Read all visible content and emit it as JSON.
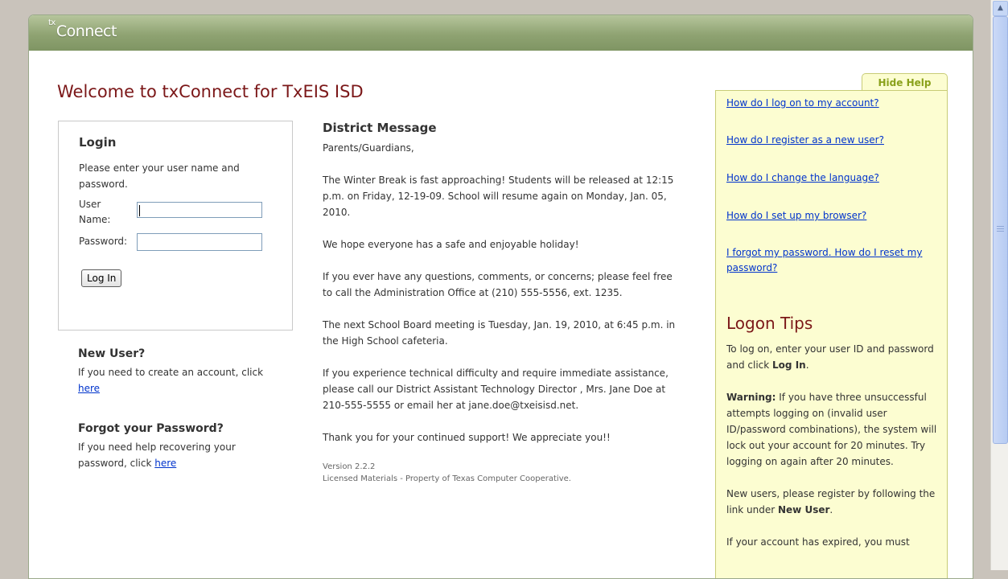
{
  "app": {
    "brand_prefix": "tx",
    "brand_name": "Connect"
  },
  "welcome": "Welcome to txConnect for TxEIS ISD",
  "login": {
    "title": "Login",
    "instructions": "Please enter your user name and password.",
    "username_label": "User Name:",
    "username_value": "",
    "password_label": "Password:",
    "password_value": "",
    "button_label": "Log In"
  },
  "new_user": {
    "title": "New User?",
    "text": "If you need to create an account, click ",
    "link": "here"
  },
  "forgot": {
    "title": "Forgot your Password?",
    "text": "If you need help recovering your password, click ",
    "link": "here"
  },
  "district": {
    "title": "District Message",
    "greeting": "Parents/Guardians,",
    "p1": "The Winter Break is fast approaching! Students will be released at 12:15 p.m. on Friday, 12-19-09. School will resume again on Monday, Jan. 05, 2010.",
    "p2": "We hope everyone has a safe and enjoyable holiday!",
    "p3": "If you ever have any questions, comments, or concerns; please feel free to call the Administration Office at (210) 555-5556, ext. 1235.",
    "p4": "The next School Board meeting is Tuesday, Jan. 19, 2010, at 6:45 p.m. in the High School cafeteria.",
    "p5": "If you experience technical difficulty and require immediate assistance, please call our District Assistant Technology Director , Mrs. Jane Doe at 210-555-5555 or email her at jane.doe@txeisisd.net.",
    "p6": "Thank you for your continued support! We appreciate you!!",
    "version": "Version 2.2.2",
    "license": "Licensed Materials - Property of Texas Computer Cooperative."
  },
  "help": {
    "tab_label": "Hide Help",
    "links": [
      "How do I log on to my account?",
      "How do I register as a new user?",
      "How do I change the language?",
      "How do I set up my browser?",
      "I forgot my password. How do I reset my password?"
    ],
    "tips_title": "Logon Tips",
    "tip1_text": "To log on, enter your user ID and password and click ",
    "tip1_bold": "Log In",
    "tip1_end": ".",
    "tip2_bold": "Warning:",
    "tip2_text": " If you have three unsuccessful attempts logging on (invalid user ID/password combinations), the system will lock out your account for 20 minutes. Try logging on again after 20 minutes.",
    "tip3_text": "New users, please register by following the link under ",
    "tip3_bold": "New User",
    "tip3_end": ".",
    "tip4_text": "If your account has expired, you must"
  }
}
